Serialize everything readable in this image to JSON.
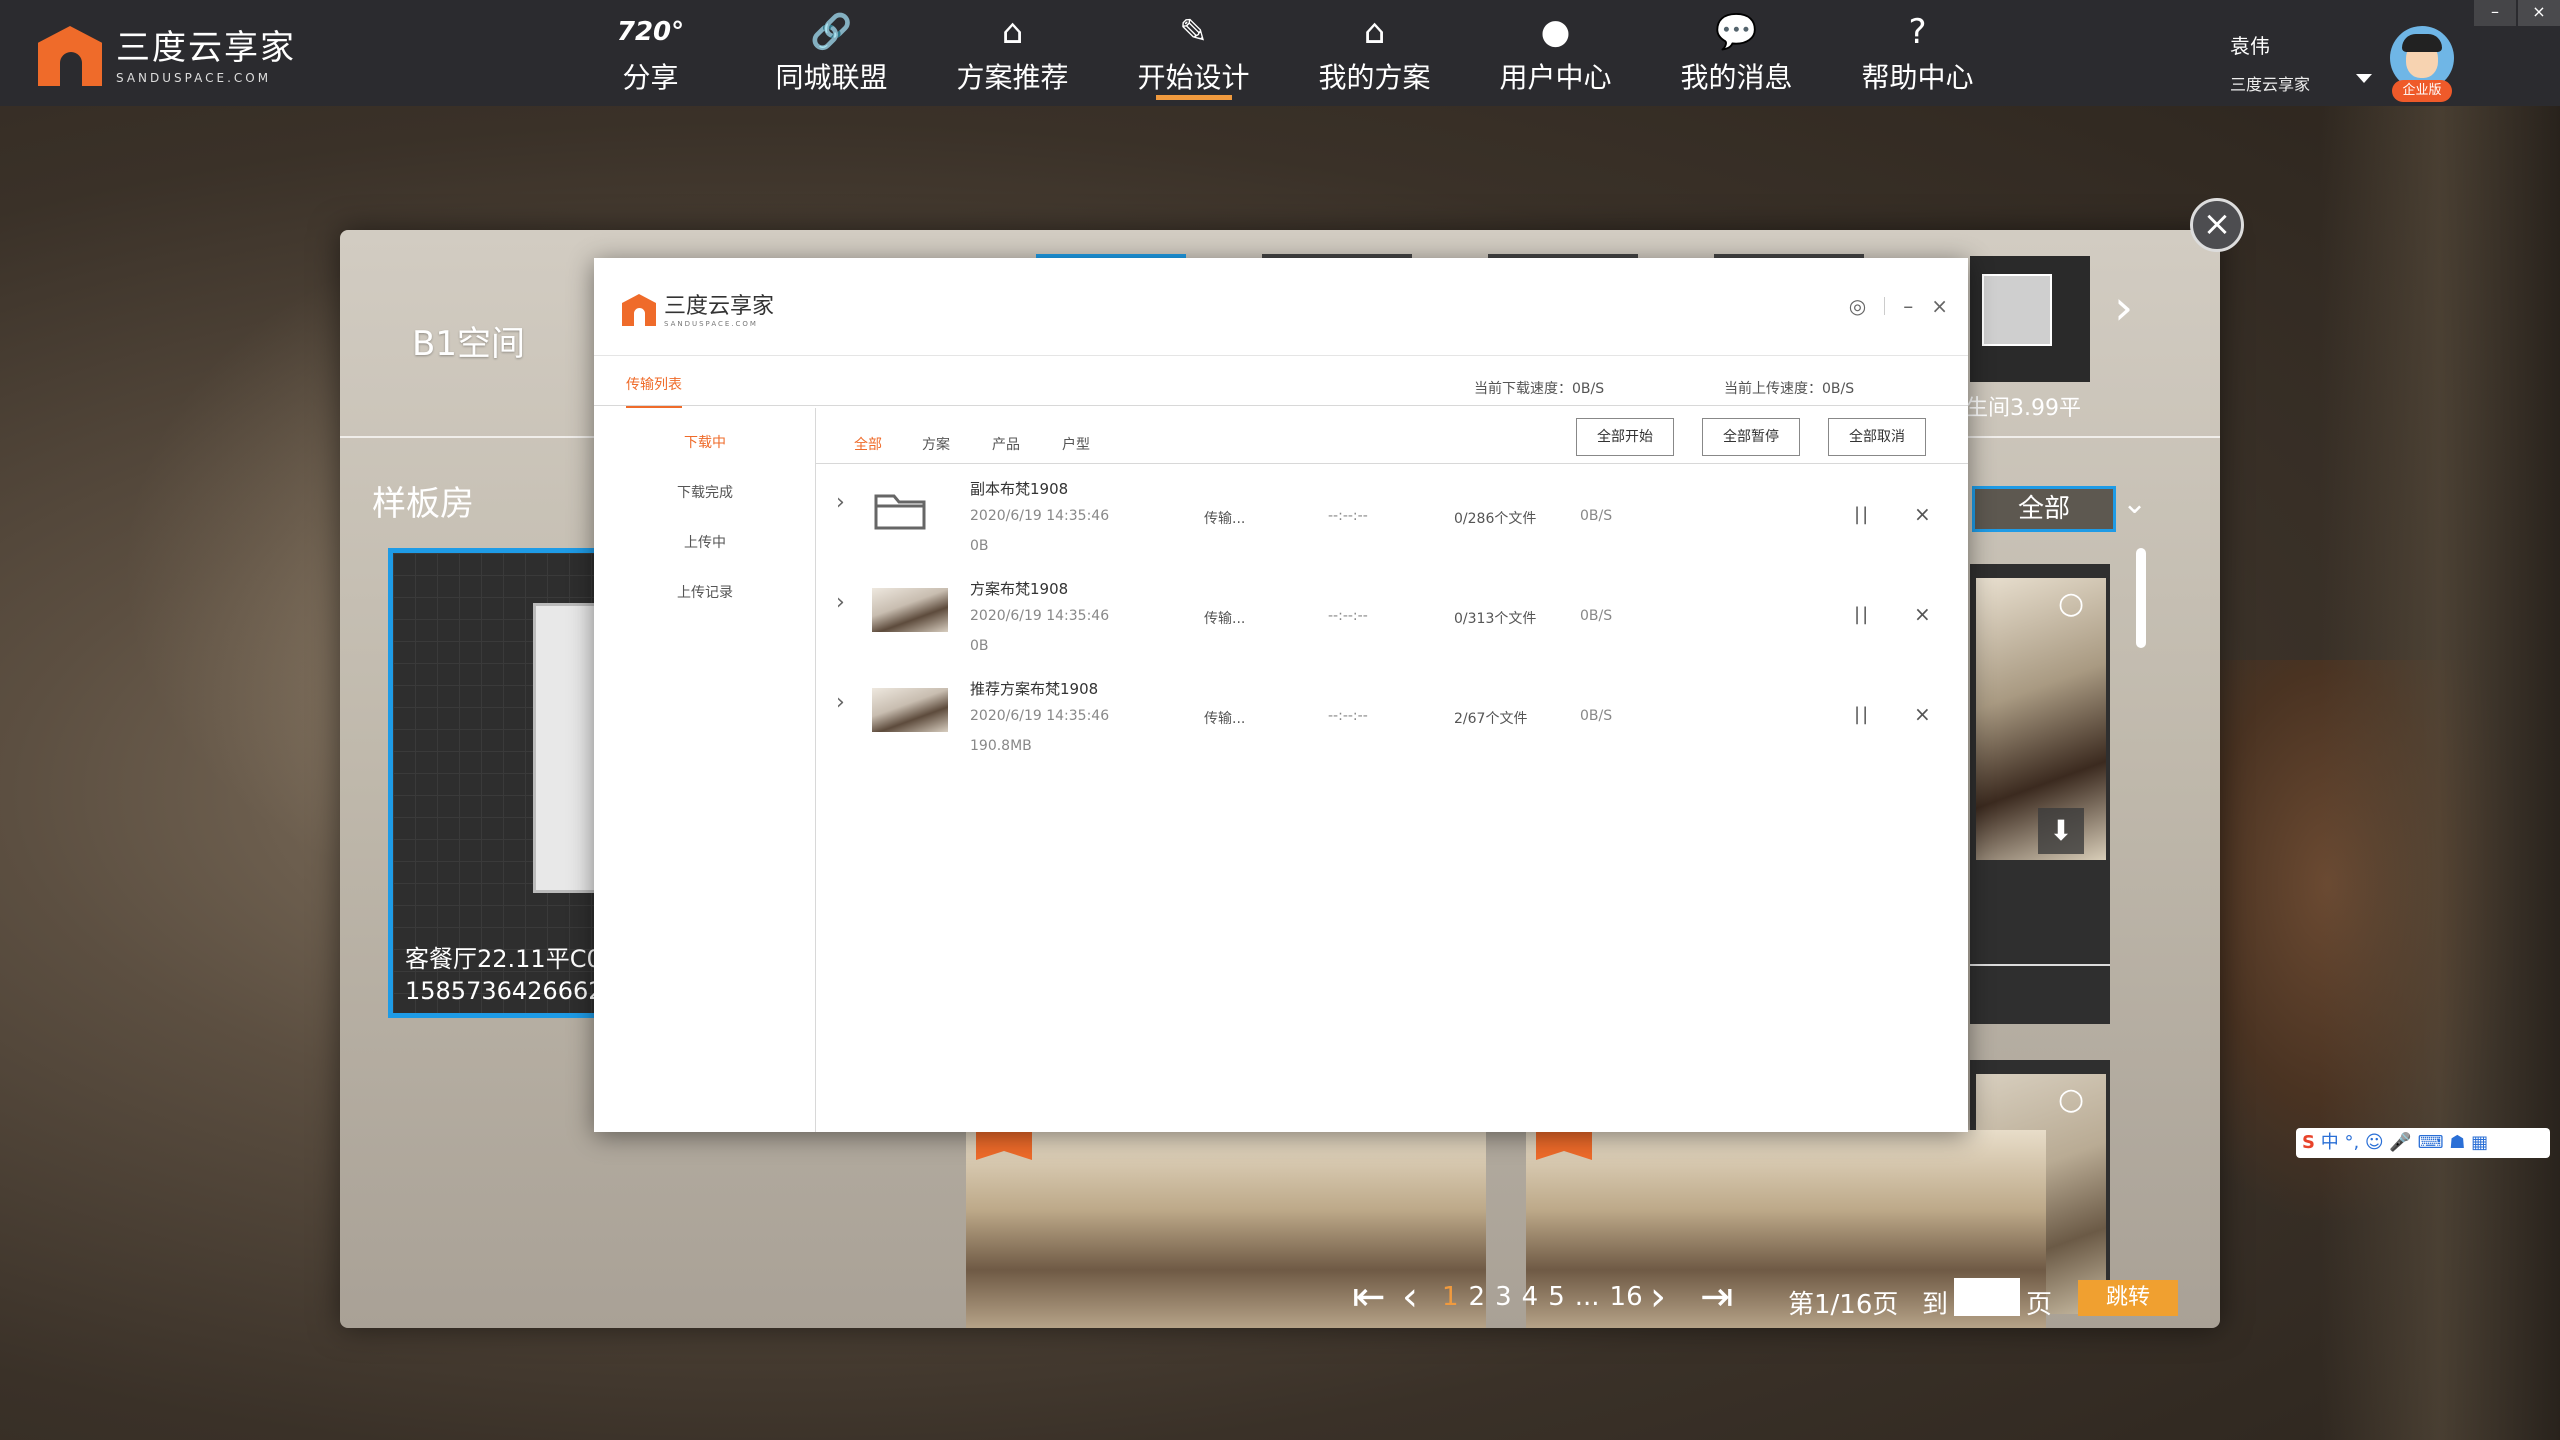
{
  "app": {
    "logo_cn": "三度云享家",
    "logo_en": "SANDUSPACE.COM"
  },
  "nav": [
    {
      "icon": "720-icon",
      "icon_text": "720°",
      "label": "分享"
    },
    {
      "icon": "link-icon",
      "label": "同城联盟"
    },
    {
      "icon": "house-lock-icon",
      "label": "方案推荐"
    },
    {
      "icon": "paint-roller-icon",
      "label": "开始设计",
      "active": true
    },
    {
      "icon": "home-icon",
      "label": "我的方案"
    },
    {
      "icon": "user-icon",
      "label": "用户中心"
    },
    {
      "icon": "chat-bubble-icon",
      "label": "我的消息"
    },
    {
      "icon": "help-bubble-icon",
      "label": "帮助中心"
    }
  ],
  "user": {
    "name": "袁伟",
    "org": "三度云享家",
    "badge": "企业版"
  },
  "window_controls": {
    "minimize": "–",
    "close": "×"
  },
  "panel": {
    "space_title": "B1空间",
    "sample_title": "样板房",
    "floor_label": "生间3.99平",
    "card_caption_1": "客餐厅22.11平C0",
    "card_caption_2": "1585736426662_",
    "filter_label": "全部",
    "close": "×"
  },
  "pager": {
    "pages": [
      "1",
      "2",
      "3",
      "4",
      "5",
      "...",
      "16"
    ],
    "current": "1",
    "info": "第1/16页",
    "to_label": "到",
    "page_label": "页",
    "jump": "跳转"
  },
  "dialog": {
    "logo_cn": "三度云享家",
    "logo_en": "SANDUSPACE.COM",
    "tab": "传输列表",
    "download_speed": "当前下载速度：0B/S",
    "upload_speed": "当前上传速度：0B/S",
    "sidebar": [
      "下载中",
      "下载完成",
      "上传中",
      "上传记录"
    ],
    "filters": [
      "全部",
      "方案",
      "产品",
      "户型"
    ],
    "buttons": {
      "start_all": "全部开始",
      "pause_all": "全部暂停",
      "cancel_all": "全部取消"
    },
    "rows": [
      {
        "name": "副本布梵1908",
        "time": "2020/6/19 14:35:46",
        "size": "0B",
        "status": "传输...",
        "eta": "--:--:--",
        "files": "0/286个文件",
        "speed": "0B/S",
        "thumb": "folder"
      },
      {
        "name": "方案布梵1908",
        "time": "2020/6/19 14:35:46",
        "size": "0B",
        "status": "传输...",
        "eta": "--:--:--",
        "files": "0/313个文件",
        "speed": "0B/S",
        "thumb": "photo"
      },
      {
        "name": "推荐方案布梵1908",
        "time": "2020/6/19 14:35:46",
        "size": "190.8MB",
        "status": "传输...",
        "eta": "--:--:--",
        "files": "2/67个文件",
        "speed": "0B/S",
        "thumb": "photo"
      }
    ]
  },
  "ime": {
    "label": "中"
  }
}
